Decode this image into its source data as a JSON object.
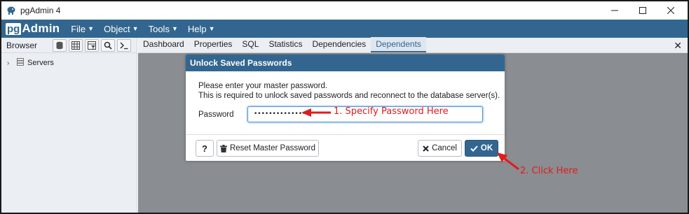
{
  "window": {
    "title": "pgAdmin 4"
  },
  "logo": {
    "pg": "pg",
    "admin": "Admin"
  },
  "menu": {
    "items": [
      {
        "label": "File"
      },
      {
        "label": "Object"
      },
      {
        "label": "Tools"
      },
      {
        "label": "Help"
      }
    ]
  },
  "browser": {
    "title": "Browser",
    "tree": [
      {
        "label": "Servers"
      }
    ]
  },
  "tabs": [
    {
      "label": "Dashboard"
    },
    {
      "label": "Properties"
    },
    {
      "label": "SQL"
    },
    {
      "label": "Statistics"
    },
    {
      "label": "Dependencies"
    },
    {
      "label": "Dependents"
    }
  ],
  "dialog": {
    "title": "Unlock Saved Passwords",
    "line1": "Please enter your master password.",
    "line2": "This is required to unlock saved passwords and reconnect to the database server(s).",
    "password_label": "Password",
    "password_value": "•••••••••••••••",
    "help_label": "?",
    "reset_label": "Reset Master Password",
    "cancel_label": "Cancel",
    "ok_label": "OK"
  },
  "annotations": {
    "step1": "1. Specify Password Here",
    "step2": "2. Click Here"
  },
  "colors": {
    "brand": "#326690",
    "annotation": "#e21b1b"
  }
}
